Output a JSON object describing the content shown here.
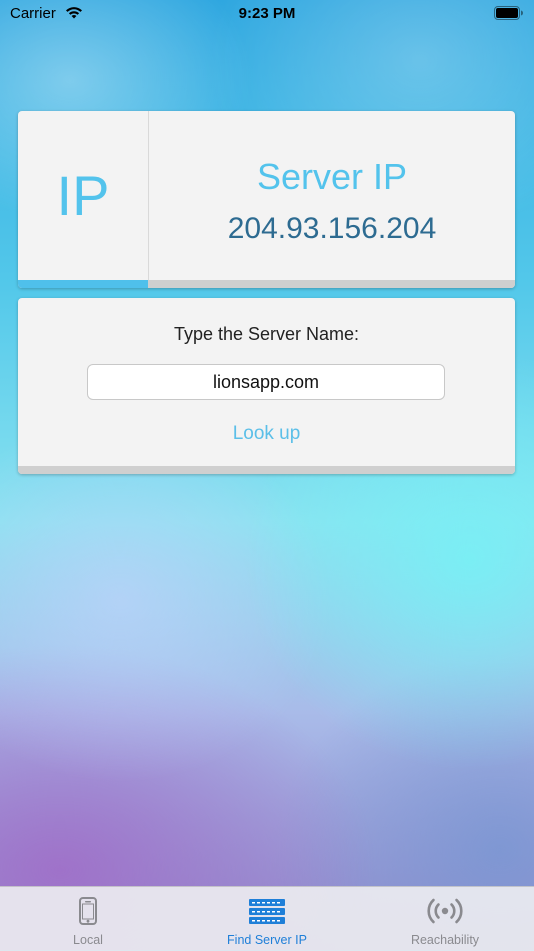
{
  "status_bar": {
    "carrier": "Carrier",
    "time": "9:23 PM"
  },
  "ip_card": {
    "badge": "IP",
    "title": "Server IP",
    "address": "204.93.156.204"
  },
  "lookup_card": {
    "label": "Type the Server Name:",
    "input_value": "lionsapp.com",
    "button": "Look up"
  },
  "tab_bar": {
    "tabs": [
      {
        "label": "Local",
        "icon": "phone-icon"
      },
      {
        "label": "Find Server IP",
        "icon": "server-icon",
        "selected": true
      },
      {
        "label": "Reachability",
        "icon": "broadcast-icon"
      }
    ]
  },
  "colors": {
    "accent": "#53c3ec",
    "ip_text": "#2d6b91",
    "tab_selected": "#1f7fd8"
  }
}
